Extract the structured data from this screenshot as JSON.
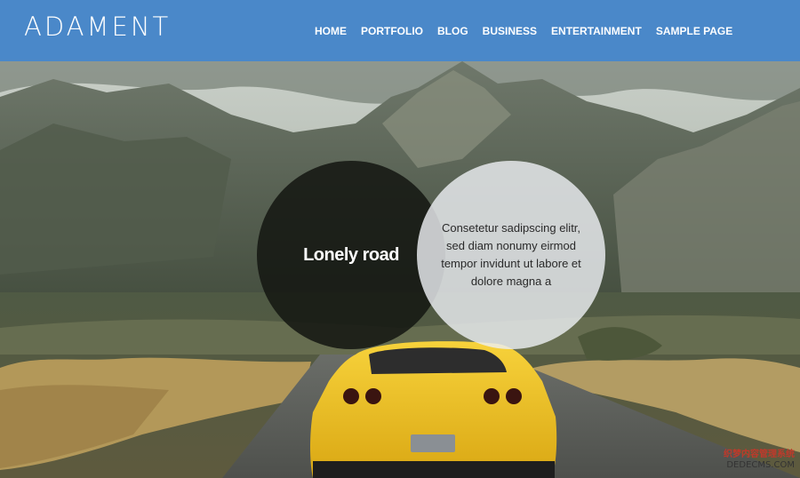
{
  "brand": {
    "logo": "ADAMENT"
  },
  "nav": {
    "items": [
      "HOME",
      "PORTFOLIO",
      "BLOG",
      "BUSINESS",
      "ENTERTAINMENT",
      "SAMPLE PAGE"
    ]
  },
  "hero": {
    "title": "Lonely road",
    "text": "Consetetur sadipscing elitr, sed diam nonumy eirmod tempor invidunt ut labore et dolore magna a"
  },
  "watermark": {
    "line1": "织梦内容管理系统",
    "line2": "DEDECMS.COM"
  },
  "colors": {
    "header": "#4a88c9",
    "car": "#f2c019"
  }
}
